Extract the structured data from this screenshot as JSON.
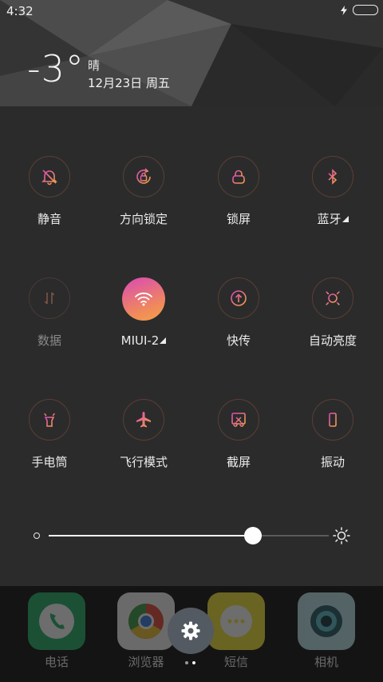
{
  "status": {
    "time": "4:32"
  },
  "weather": {
    "temperature": "-3°",
    "condition": "晴",
    "date": "12月23日 周五"
  },
  "tiles": [
    {
      "label": "静音",
      "icon": "mute-bell-icon"
    },
    {
      "label": "方向锁定",
      "icon": "rotation-lock-icon"
    },
    {
      "label": "锁屏",
      "icon": "lock-screen-icon"
    },
    {
      "label": "蓝牙",
      "icon": "bluetooth-icon"
    },
    {
      "label": "数据",
      "icon": "mobile-data-icon"
    },
    {
      "label": "MIUI-2",
      "icon": "wifi-icon"
    },
    {
      "label": "快传",
      "icon": "quick-transfer-icon"
    },
    {
      "label": "自动亮度",
      "icon": "auto-brightness-icon"
    },
    {
      "label": "手电筒",
      "icon": "flashlight-icon"
    },
    {
      "label": "飞行模式",
      "icon": "airplane-icon"
    },
    {
      "label": "截屏",
      "icon": "screenshot-icon"
    },
    {
      "label": "振动",
      "icon": "vibrate-icon"
    }
  ],
  "brightness": {
    "level": 0.73
  },
  "dock": {
    "apps": [
      {
        "label": "电话",
        "icon": "phone-icon"
      },
      {
        "label": "浏览器",
        "icon": "browser-icon"
      },
      {
        "label": "短信",
        "icon": "messages-icon"
      },
      {
        "label": "相机",
        "icon": "camera-icon"
      }
    ]
  },
  "colors": {
    "accent_start": "#d94ab4",
    "accent_end": "#f4a247",
    "panel_bg": "#2b2b2b"
  }
}
